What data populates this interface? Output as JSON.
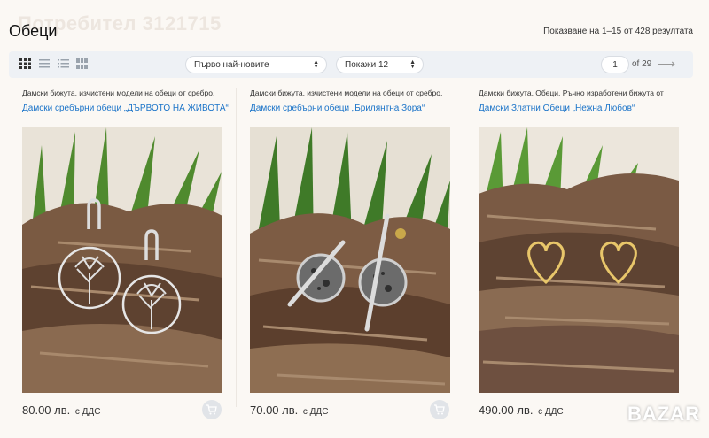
{
  "watermark": {
    "user": "Потребител 3121715"
  },
  "page": {
    "title": "Обеци",
    "results": "Показване на 1–15 от 428 резултата"
  },
  "toolbar": {
    "view_icons": [
      "grid-large-icon",
      "list-icon",
      "list-detailed-icon",
      "grid-small-icon"
    ],
    "sort_value": "Първо най-новите",
    "show_value": "Покажи 12",
    "page_current": "1",
    "page_of": "of 29",
    "next_arrow": "⟶"
  },
  "products": [
    {
      "category": "Дамски бижута, изчистени модели на обеци от сребро,",
      "title": "Дамски сребърни обеци „ДЪРВОТО НА ЖИВОТА“",
      "price": "80.00 лв.",
      "vat": "с ДДС"
    },
    {
      "category": "Дамски бижута, изчистени модели на обеци от сребро,",
      "title": "Дамски сребърни обеци „Брилянтна Зора“",
      "price": "70.00 лв.",
      "vat": "с ДДС"
    },
    {
      "category": "Дамски бижута, Обеци, Ръчно изработени бижута от",
      "title": "Дамски Златни Обеци „Нежна Любов“",
      "price": "490.00 лв.",
      "vat": "с ДДС"
    }
  ],
  "logo": "BAZAR",
  "colors": {
    "link": "#1a73c8",
    "toolbar_bg": "#eef1f5",
    "page_bg": "#fbf8f4"
  }
}
